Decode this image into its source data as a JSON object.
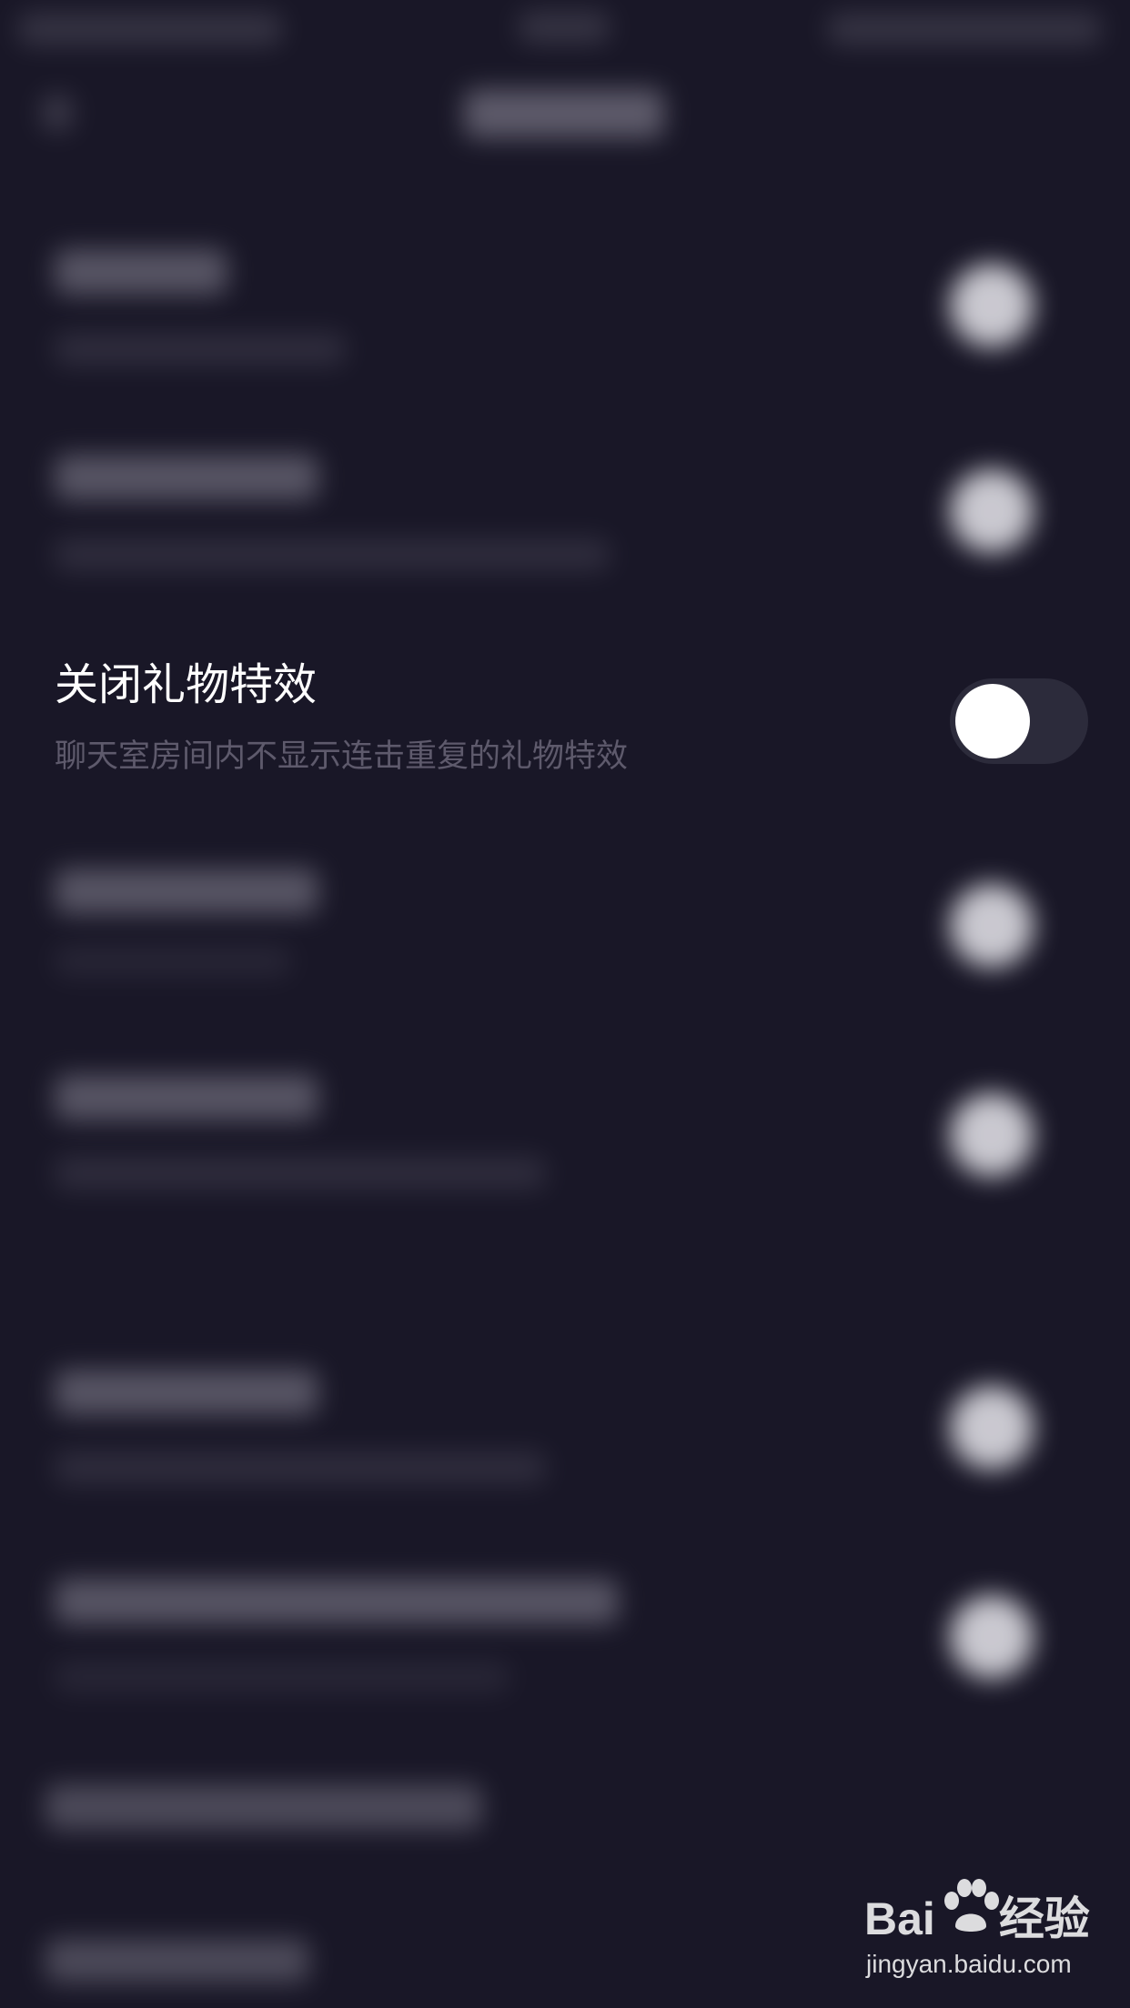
{
  "settings": {
    "focused_item": {
      "title": "关闭礼物特效",
      "description": "聊天室房间内不显示连击重复的礼物特效",
      "toggle_state": "off"
    }
  },
  "watermark": {
    "logo_left": "Bai",
    "logo_right": "经验",
    "url": "jingyan.baidu.com"
  },
  "colors": {
    "background": "#191727",
    "title_text": "#ffffff",
    "description_text": "#5e5a6c",
    "toggle_track": "#2c2b3b",
    "toggle_knob": "#ffffff"
  }
}
